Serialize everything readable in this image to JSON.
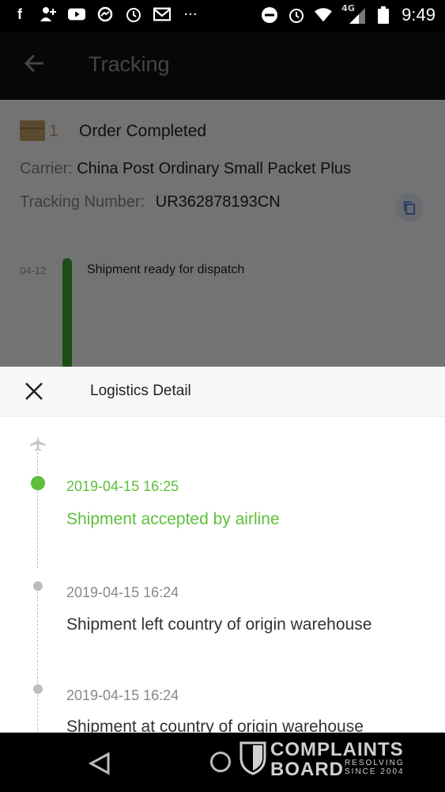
{
  "status_bar": {
    "time": "9:49",
    "network": "4G",
    "icons": [
      "facebook-icon",
      "add-person-icon",
      "youtube-icon",
      "messenger-icon",
      "alarm-icon",
      "gmail-icon",
      "more-icon",
      "dnd-icon",
      "alarm-icon",
      "wifi-icon",
      "signal-icon",
      "battery-icon"
    ]
  },
  "header": {
    "title": "Tracking"
  },
  "order": {
    "count": "1",
    "status": "Order Completed",
    "carrier_label": "Carrier:",
    "carrier": "China Post Ordinary Small Packet Plus",
    "tracking_label": "Tracking Number:",
    "tracking_number": "UR362878193CN"
  },
  "timeline_preview": {
    "date": "04-12",
    "text": "Shipment ready for dispatch"
  },
  "sheet": {
    "title": "Logistics Detail",
    "events": [
      {
        "time": "2019-04-15 16:25",
        "desc": "Shipment accepted by airline",
        "active": true
      },
      {
        "time": "2019-04-15 16:24",
        "desc": "Shipment left country of origin warehouse",
        "active": false
      },
      {
        "time": "2019-04-15 16:24",
        "desc": "Shipment at country of origin warehouse",
        "active": false
      }
    ]
  },
  "watermark": {
    "line1": "COMPLAINTS",
    "line2": "BOARD",
    "tag1": "RESOLVING",
    "tag2": "SINCE 2004"
  },
  "colors": {
    "accent_green": "#5dbf3c",
    "timeline_green": "#3aad2c",
    "appbar": "#111111"
  }
}
